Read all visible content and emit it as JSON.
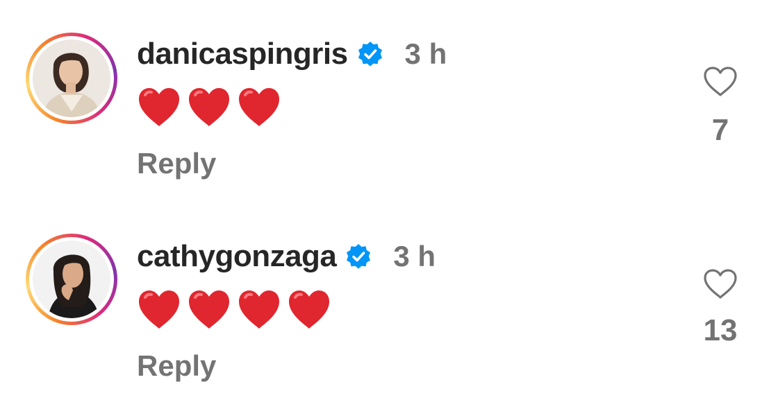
{
  "comments": [
    {
      "username": "danicaspingris",
      "time": "3 h",
      "text_emoji": "❤️❤️❤️",
      "heart_count": 3,
      "reply_label": "Reply",
      "likes": "7",
      "verified": true,
      "avatar_icon": "profile-photo-woman-blazer"
    },
    {
      "username": "cathygonzaga",
      "time": "3 h",
      "text_emoji": "❤️❤️❤️❤️",
      "heart_count": 4,
      "reply_label": "Reply",
      "likes": "13",
      "verified": true,
      "avatar_icon": "profile-photo-woman-dark-top"
    }
  ],
  "colors": {
    "verified_blue": "#0095f6",
    "heart_red": "#e0262e",
    "muted_text": "#737373",
    "primary_text": "#262626"
  },
  "icons": {
    "like": "heart-outline-icon",
    "verified": "verified-badge-icon"
  }
}
